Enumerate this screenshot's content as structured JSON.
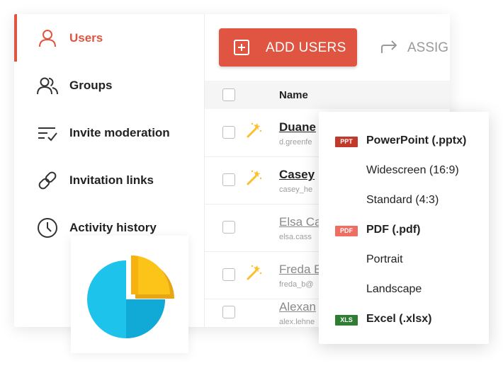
{
  "sidebar": {
    "items": [
      {
        "label": "Users",
        "icon": "user-icon",
        "active": true
      },
      {
        "label": "Groups",
        "icon": "groups-icon",
        "active": false
      },
      {
        "label": "Invite moderation",
        "icon": "moderation-icon",
        "active": false
      },
      {
        "label": "Invitation links",
        "icon": "link-icon",
        "active": false
      },
      {
        "label": "Activity history",
        "icon": "clock-icon",
        "active": false
      }
    ]
  },
  "toolbar": {
    "add_users_label": "ADD USERS",
    "assign_label": "ASSIG"
  },
  "table": {
    "header": {
      "name": "Name"
    },
    "rows": [
      {
        "name": "Duane",
        "email": "d.greenfe",
        "wand": true
      },
      {
        "name": "Casey",
        "email": "casey_he",
        "wand": true
      },
      {
        "name": "Elsa Ca",
        "email": "elsa.cass",
        "wand": false
      },
      {
        "name": "Freda E",
        "email": "freda_b@",
        "wand": true
      },
      {
        "name": "Alexan",
        "email": "alex.lehne",
        "wand": false
      }
    ]
  },
  "export_menu": {
    "items": [
      {
        "badge": "PPT",
        "label": "PowerPoint (.pptx)"
      },
      {
        "badge": "",
        "label": "Widescreen (16:9)"
      },
      {
        "badge": "",
        "label": "Standard (4:3)"
      },
      {
        "badge": "PDF",
        "label": "PDF (.pdf)"
      },
      {
        "badge": "",
        "label": "Portrait"
      },
      {
        "badge": "",
        "label": "Landscape"
      },
      {
        "badge": "XLS",
        "label": "Excel (.xlsx)"
      }
    ]
  },
  "colors": {
    "accent": "#e05542",
    "ppt_badge": "#c0392b",
    "pdf_badge": "#ef6e62",
    "xls_badge": "#2e7d32",
    "pie_blue": "#1ec3ec",
    "pie_yellow": "#fcc418"
  }
}
